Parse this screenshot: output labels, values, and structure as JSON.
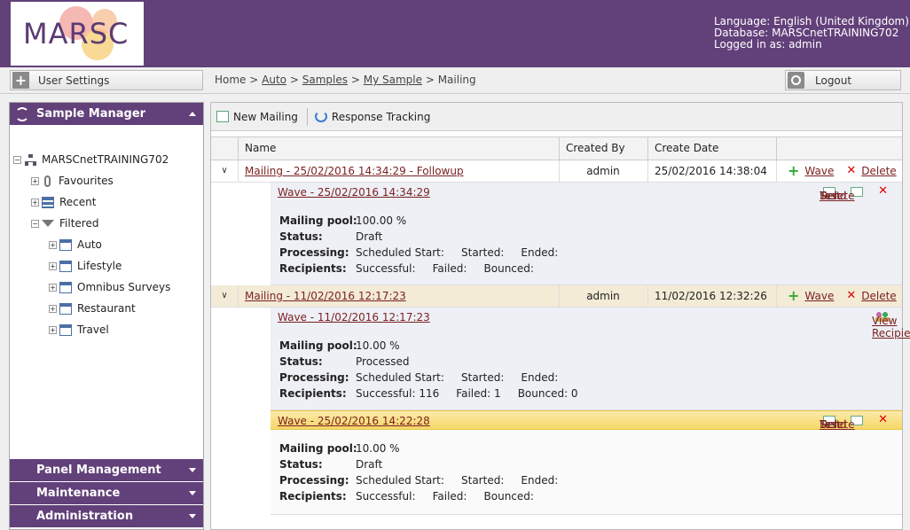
{
  "header": {
    "logo_text": "MARSC",
    "language": "Language: English (United Kingdom)",
    "database": "Database: MARSCnetTRAINING702",
    "logged_in": "Logged in as: admin"
  },
  "topbar": {
    "user_settings": "User Settings",
    "logout": "Logout",
    "breadcrumb": {
      "home": "Home",
      "sep": ">",
      "auto": "Auto",
      "samples": "Samples",
      "my_sample": "My Sample",
      "current": "Mailing"
    }
  },
  "sidebar": {
    "sample_manager": "Sample Manager",
    "panel_management": "Panel Management",
    "maintenance": "Maintenance",
    "administration": "Administration",
    "tree": {
      "root": "MARSCnetTRAINING702",
      "favourites": "Favourites",
      "recent": "Recent",
      "filtered": "Filtered",
      "children": [
        "Auto",
        "Lifestyle",
        "Omnibus Surveys",
        "Restaurant",
        "Travel"
      ]
    }
  },
  "toolbar": {
    "new_mailing": "New Mailing",
    "response_tracking": "Response Tracking"
  },
  "grid": {
    "headers": {
      "name": "Name",
      "created_by": "Created By",
      "create_date": "Create Date"
    },
    "labels": {
      "wave": "Wave",
      "delete": "Delete",
      "test": "Test",
      "send": "Send",
      "view_recipients": "View Recipients",
      "mailing_pool": "Mailing pool:",
      "status": "Status:",
      "processing": "Processing:",
      "recipients": "Recipients:"
    },
    "mailings": [
      {
        "name": "Mailing - 25/02/2016 14:34:29 - Followup",
        "created_by": "admin",
        "create_date": "25/02/2016 14:38:04",
        "waves": [
          {
            "title": "Wave - 25/02/2016 14:34:29",
            "pool": "100.00 %",
            "status": "Draft",
            "processing": "Scheduled Start:     Started:     Ended:",
            "recipients": "Successful:     Failed:     Bounced:"
          }
        ]
      },
      {
        "name": "Mailing - 11/02/2016 12:17:23",
        "created_by": "admin",
        "create_date": "11/02/2016 12:32:26",
        "waves": [
          {
            "title": "Wave - 11/02/2016 12:17:23",
            "pool": "10.00 %",
            "status": "Processed",
            "processing": "Scheduled Start:     Started:     Ended:",
            "recipients": "Successful: 116     Failed: 1     Bounced: 0"
          },
          {
            "title": "Wave - 25/02/2016 14:22:28",
            "pool": "10.00 %",
            "status": "Draft",
            "processing": "Scheduled Start:     Started:     Ended:",
            "recipients": "Successful:     Failed:     Bounced:"
          }
        ]
      }
    ]
  }
}
